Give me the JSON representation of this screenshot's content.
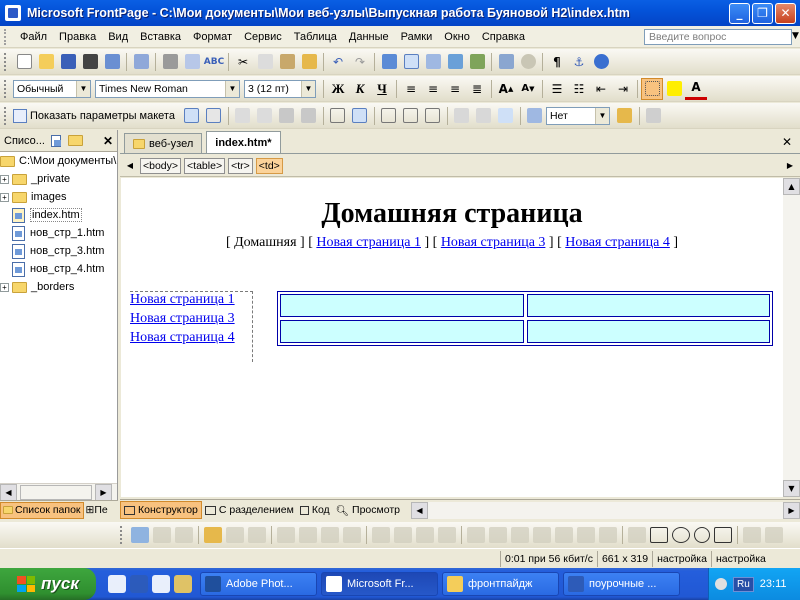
{
  "window": {
    "title": "Microsoft FrontPage - C:\\Мои документы\\Мои веб-узлы\\Выпускная работа Буяновой Н2\\index.htm"
  },
  "menubar": {
    "items": [
      "Файл",
      "Правка",
      "Вид",
      "Вставка",
      "Формат",
      "Сервис",
      "Таблица",
      "Данные",
      "Рамки",
      "Окно",
      "Справка"
    ],
    "help_placeholder": "Введите вопрос"
  },
  "format_toolbar": {
    "style": "Обычный",
    "font": "Times New Roman",
    "size": "3  (12 пт)",
    "bold": "Ж",
    "italic": "К",
    "underline": "Ч"
  },
  "layout_toolbar": {
    "show_layout_label": "Показать параметры макета",
    "cell_color": "Нет"
  },
  "folder_panel": {
    "title": "Списо...",
    "items": [
      {
        "label": "C:\\Мои документы\\Мои веб-узлы\\",
        "type": "root"
      },
      {
        "label": "_private",
        "type": "folder"
      },
      {
        "label": "images",
        "type": "folder"
      },
      {
        "label": "index.htm",
        "type": "file"
      },
      {
        "label": "нов_стр_1.htm",
        "type": "file"
      },
      {
        "label": "нов_стр_3.htm",
        "type": "file"
      },
      {
        "label": "нов_стр_4.htm",
        "type": "file"
      },
      {
        "label": "_borders",
        "type": "folder"
      }
    ],
    "tabs": [
      "Список папок",
      "Пе"
    ]
  },
  "document": {
    "tabs": [
      "веб-узел",
      "index.htm*"
    ],
    "tag_path": [
      "<body>",
      "<table>",
      "<tr>",
      "<td>"
    ],
    "heading": "Домашняя страница",
    "nav": {
      "current": "Домашняя",
      "links": [
        "Новая страница 1",
        "Новая страница 3",
        "Новая страница 4"
      ]
    },
    "side_links": [
      "Новая страница 1",
      "Новая страница 3",
      "Новая страница 4"
    ],
    "table_cell_color": "#CCFFFF"
  },
  "view_tabs": [
    "Конструктор",
    "С разделением",
    "Код",
    "Просмотр"
  ],
  "status": {
    "download": "0:01 при 56 кбит/с",
    "size": "661 x 319",
    "mode1": "настройка",
    "mode2": "настройка"
  },
  "taskbar": {
    "start": "пуск",
    "items": [
      "Adobe Phot...",
      "Microsoft Fr...",
      "фронтпайдж",
      "поурочные ..."
    ],
    "lang": "Ru",
    "time": "23:11"
  },
  "colors": {
    "accent": "#0A5FE4",
    "cell": "#CCFFFF",
    "link": "#0000EE",
    "active_tab": "#F8C27F"
  }
}
